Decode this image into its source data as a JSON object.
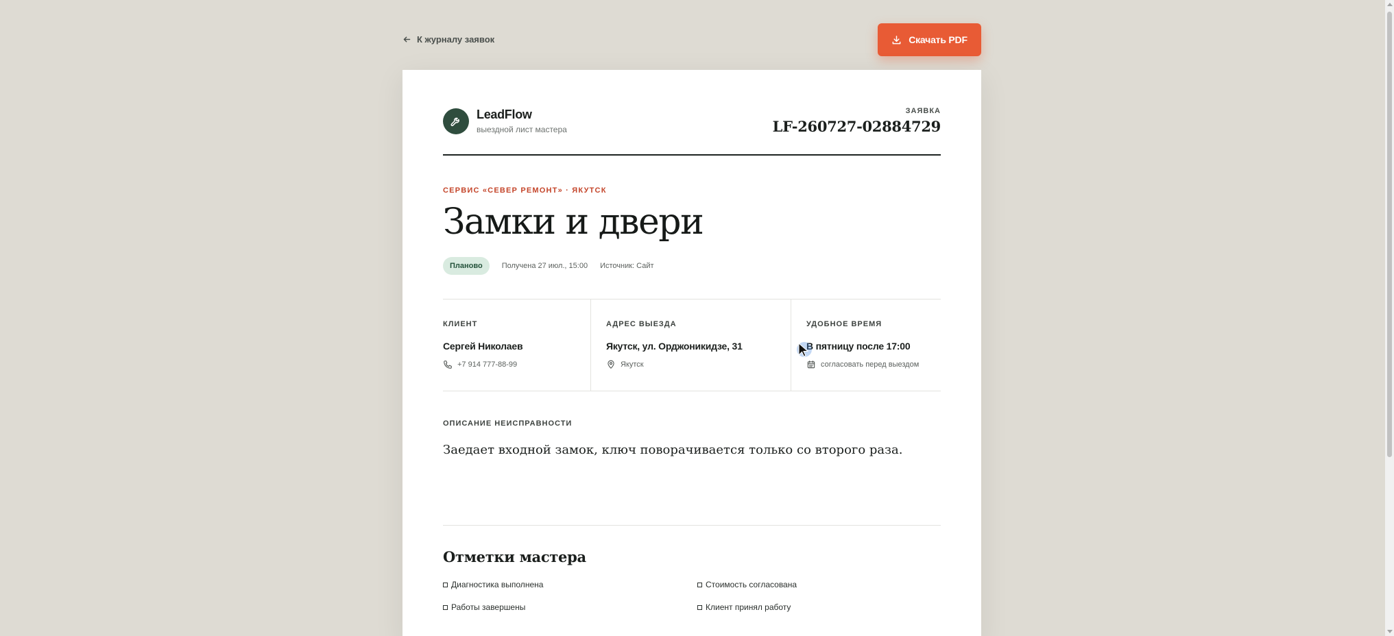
{
  "nav": {
    "back_label": "К журналу заявок",
    "download_label": "Скачать PDF"
  },
  "brand": {
    "name": "LeadFlow",
    "subtitle": "выездной лист мастера"
  },
  "request": {
    "label": "ЗАЯВКА",
    "number": "LF-260727-02884729"
  },
  "service": {
    "eyebrow": "СЕРВИС «СЕВЕР РЕМОНТ» · ЯКУТСК",
    "title": "Замки и двери"
  },
  "meta": {
    "badge": "Планово",
    "received": "Получена 27 июл., 15:00",
    "source": "Источник: Сайт"
  },
  "info": {
    "client": {
      "label": "КЛИЕНТ",
      "name": "Сергей Николаев",
      "phone": "+7 914 777-88-99"
    },
    "address": {
      "label": "АДРЕС ВЫЕЗДА",
      "value": "Якутск, ул. Орджоникидзе, 31",
      "city": "Якутск"
    },
    "time": {
      "label": "УДОБНОЕ ВРЕМЯ",
      "value": "В пятницу после 17:00",
      "note": "согласовать перед выездом"
    }
  },
  "description": {
    "label": "ОПИСАНИЕ НЕИСПРАВНОСТИ",
    "text": "Заедает входной замок, ключ поворачивается только со второго раза."
  },
  "notes": {
    "title": "Отметки мастера",
    "items": [
      "Диагностика выполнена",
      "Стоимость согласована",
      "Работы завершены",
      "Клиент принял работу"
    ]
  },
  "colors": {
    "accent": "#e85b35",
    "brand": "#2f4d3e",
    "eyebrow": "#c4452a",
    "badge_bg": "#d9ebe0"
  },
  "icons": {
    "back": "arrow-left-icon",
    "download": "download-icon",
    "logo": "wrench-icon",
    "phone": "phone-icon",
    "location": "map-pin-icon",
    "calendar": "calendar-icon"
  }
}
